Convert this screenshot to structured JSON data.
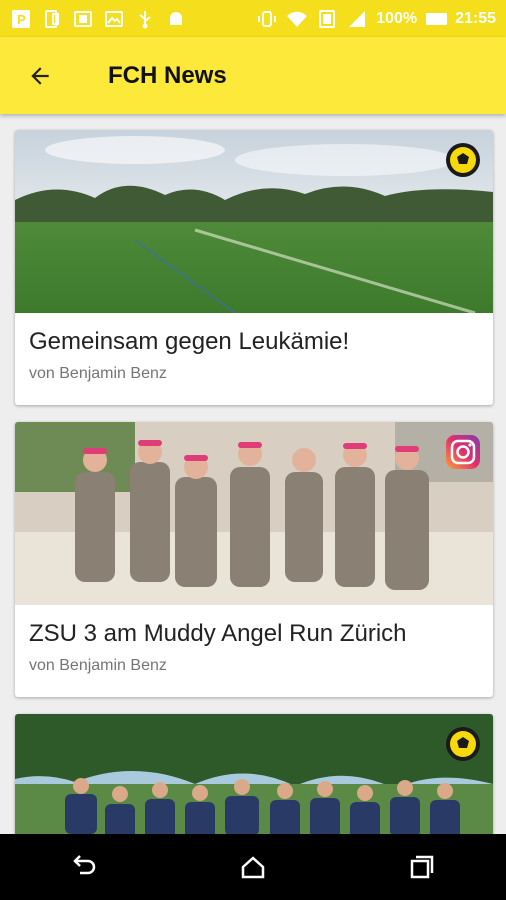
{
  "status_bar": {
    "battery": "100%",
    "time": "21:55",
    "icons": [
      "app-p-icon",
      "sim-icon",
      "screenshot-icon",
      "image-icon",
      "usb-icon",
      "android-icon",
      "vibrate-icon",
      "wifi-icon",
      "nfc-icon",
      "signal-icon",
      "battery-icon"
    ]
  },
  "app_bar": {
    "title": "FCH News",
    "back_icon": "arrow-back-icon"
  },
  "colors": {
    "status_bar": "#f5de1b",
    "app_bar": "#fde93a",
    "background": "#eeeeee"
  },
  "news": [
    {
      "title": "Gemeinsam gegen Leukämie!",
      "author": "von Benjamin Benz",
      "badge": "soccer-ball-icon"
    },
    {
      "title": "ZSU 3 am Muddy Angel Run Zürich",
      "author": "von Benjamin Benz",
      "badge": "instagram-icon"
    },
    {
      "title": "",
      "author": "",
      "badge": "soccer-ball-icon"
    }
  ],
  "nav_bar": [
    "back-nav-icon",
    "home-nav-icon",
    "recents-nav-icon"
  ]
}
